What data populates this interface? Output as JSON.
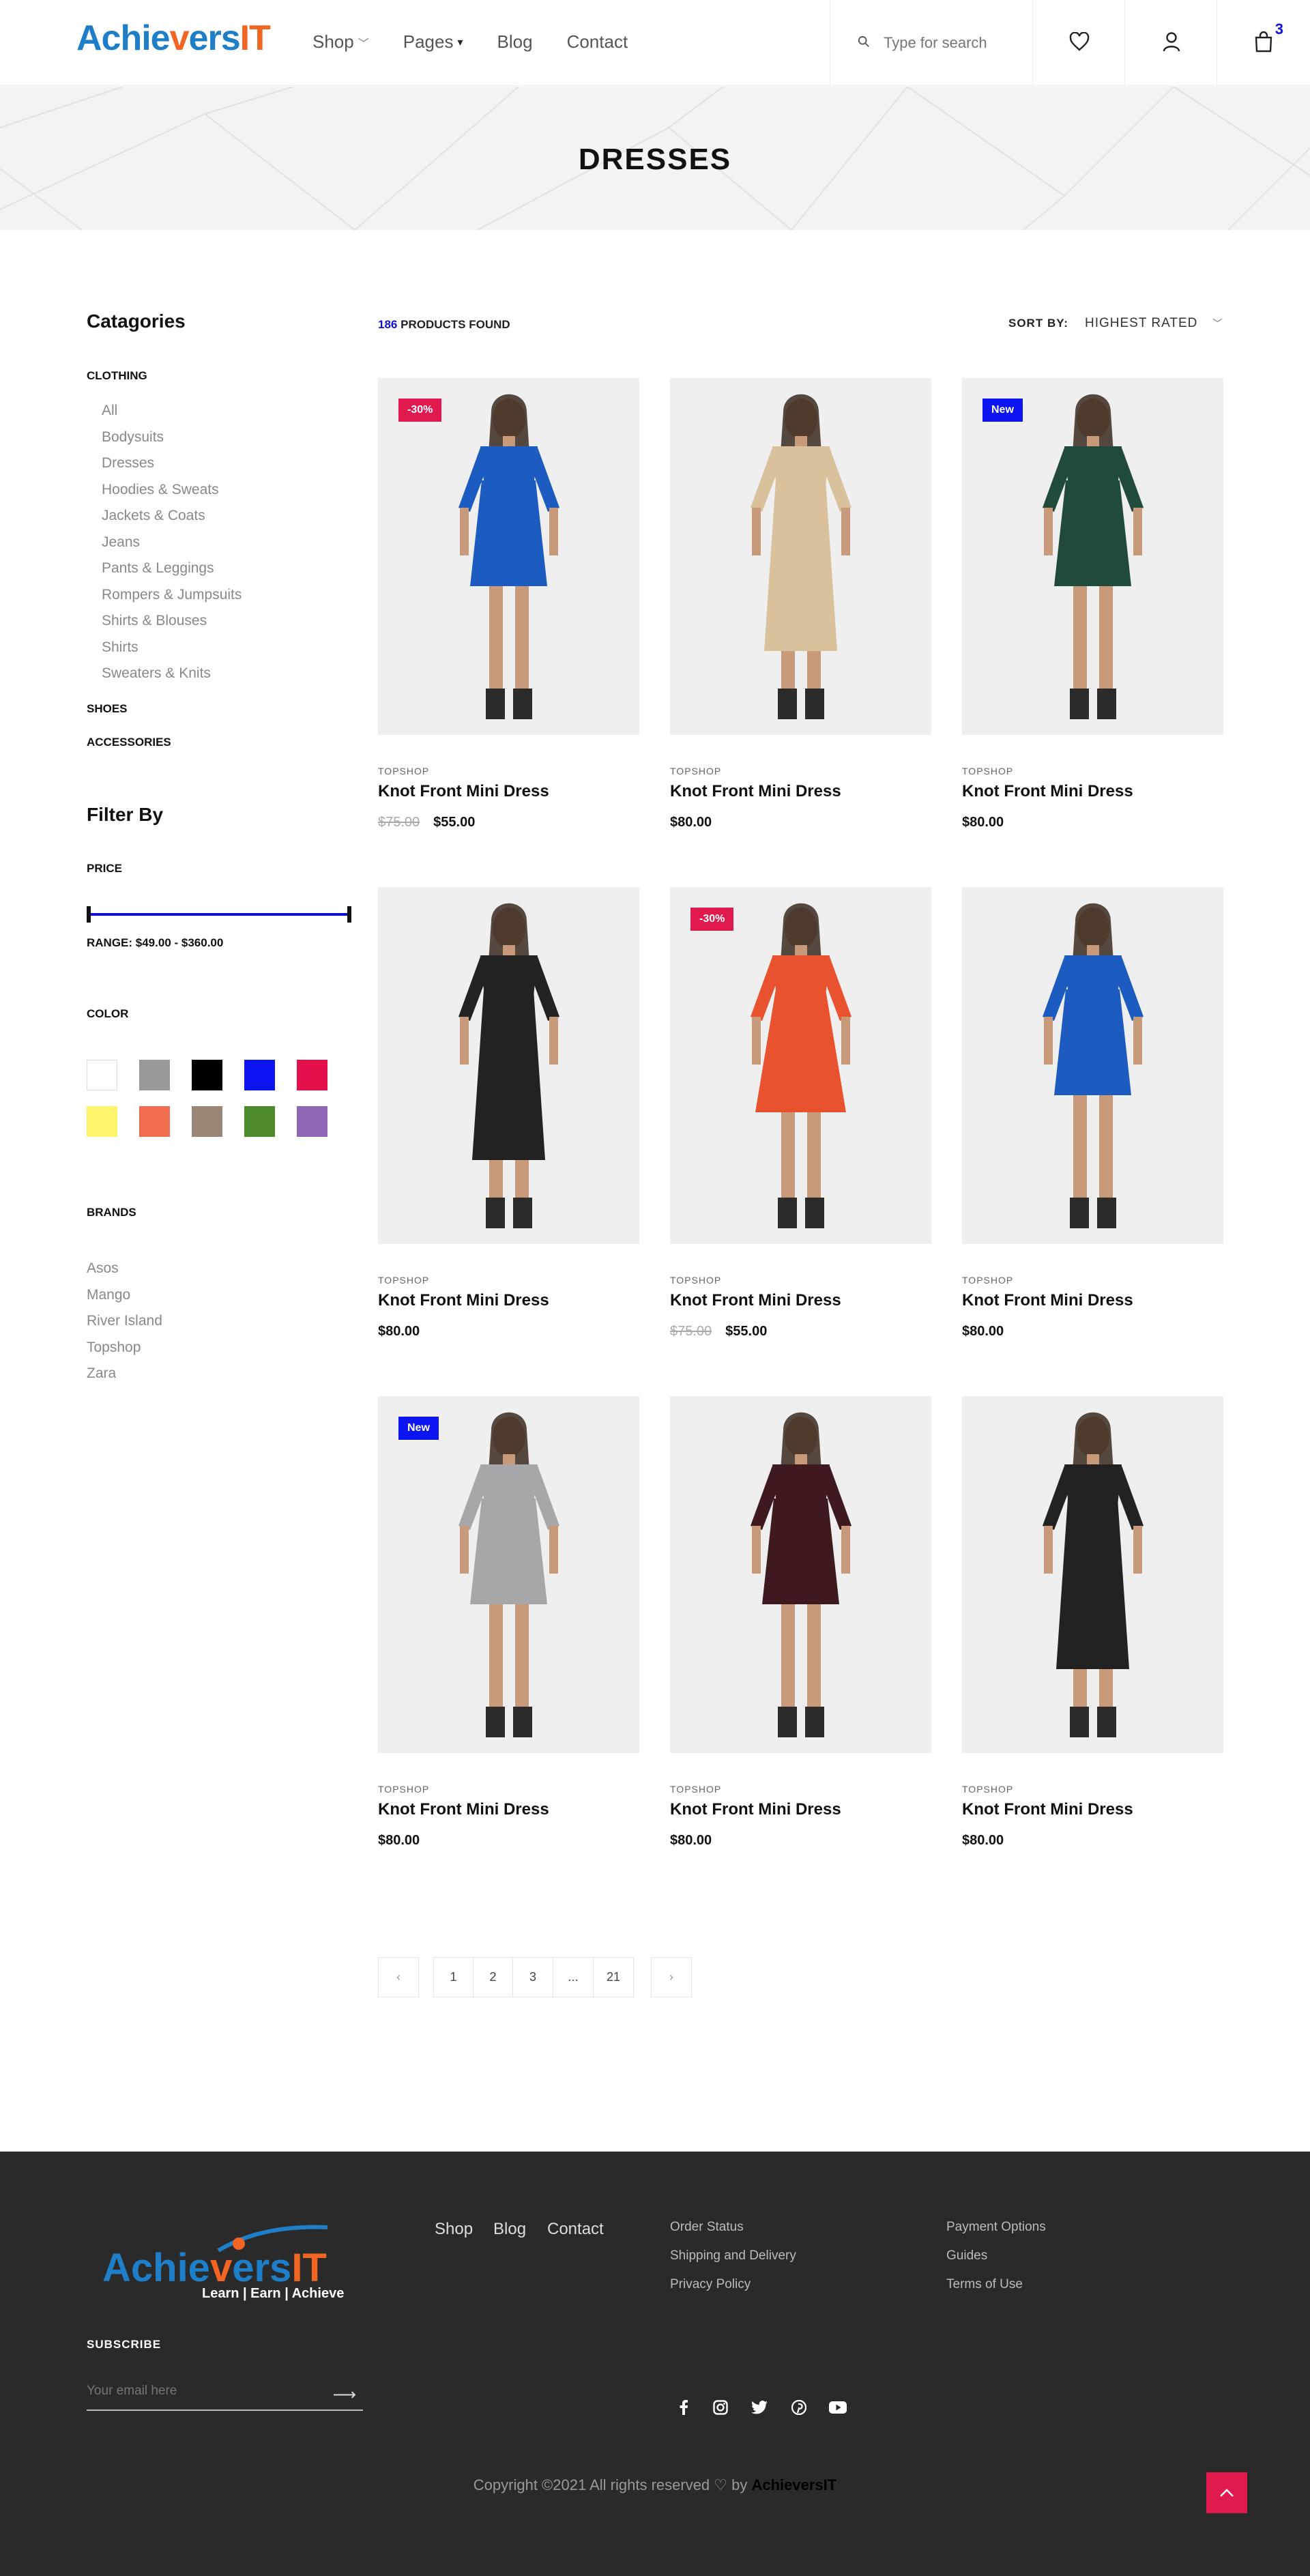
{
  "header": {
    "logo": {
      "part1": "Achie",
      "part2": "v",
      "part3": "ers",
      "part4": "IT"
    },
    "nav": [
      {
        "label": "Shop",
        "has_dropdown": true
      },
      {
        "label": "Pages",
        "has_dropdown": true
      },
      {
        "label": "Blog",
        "has_dropdown": false
      },
      {
        "label": "Contact",
        "has_dropdown": false
      }
    ],
    "search_placeholder": "Type for search",
    "cart_count": "3",
    "icons": [
      "search-icon",
      "heart-icon",
      "user-icon",
      "bag-icon"
    ]
  },
  "banner": {
    "title": "DRESSES"
  },
  "sidebar": {
    "categories_title": "Catagories",
    "clothing_label": "CLOTHING",
    "clothing_items": [
      "All",
      "Bodysuits",
      "Dresses",
      "Hoodies & Sweats",
      "Jackets & Coats",
      "Jeans",
      "Pants & Leggings",
      "Rompers & Jumpsuits",
      "Shirts & Blouses",
      "Shirts",
      "Sweaters & Knits"
    ],
    "shoes_label": "SHOES",
    "accessories_label": "ACCESSORIES",
    "filter_title": "Filter By",
    "price_label": "PRICE",
    "price_range": "RANGE: $49.00 - $360.00",
    "color_label": "COLOR",
    "colors": [
      "#ffffff",
      "#999999",
      "#000000",
      "#0d14f2",
      "#e3104c",
      "#fdf46b",
      "#f06d4d",
      "#9b8577",
      "#4d8a2b",
      "#8e66b5"
    ],
    "brands_label": "BRANDS",
    "brands": [
      "Asos",
      "Mango",
      "River Island",
      "Topshop",
      "Zara"
    ]
  },
  "toolbar": {
    "found_count": "186",
    "found_label": "PRODUCTS FOUND",
    "sort_label": "SORT BY:",
    "sort_value": "HIGHEST RATED"
  },
  "products": [
    {
      "brand": "TOPSHOP",
      "name": "Knot Front Mini Dress",
      "old_price": "$75.00",
      "price": "$55.00",
      "badge": "-30%",
      "badge_color": "#e01a4f",
      "dress_color": "#1c5bc0",
      "style": "short"
    },
    {
      "brand": "TOPSHOP",
      "name": "Knot Front Mini Dress",
      "old_price": "",
      "price": "$80.00",
      "badge": "",
      "badge_color": "",
      "dress_color": "#d8c19b",
      "style": "long"
    },
    {
      "brand": "TOPSHOP",
      "name": "Knot Front Mini Dress",
      "old_price": "",
      "price": "$80.00",
      "badge": "New",
      "badge_color": "#0d14f2",
      "dress_color": "#1f4a3c",
      "style": "short"
    },
    {
      "brand": "TOPSHOP",
      "name": "Knot Front Mini Dress",
      "old_price": "",
      "price": "$80.00",
      "badge": "",
      "badge_color": "",
      "dress_color": "#222222",
      "style": "long"
    },
    {
      "brand": "TOPSHOP",
      "name": "Knot Front Mini Dress",
      "old_price": "$75.00",
      "price": "$55.00",
      "badge": "-30%",
      "badge_color": "#e01a4f",
      "dress_color": "#e8522e",
      "style": "mini"
    },
    {
      "brand": "TOPSHOP",
      "name": "Knot Front Mini Dress",
      "old_price": "",
      "price": "$80.00",
      "badge": "",
      "badge_color": "",
      "dress_color": "#1c5bc0",
      "style": "short"
    },
    {
      "brand": "TOPSHOP",
      "name": "Knot Front Mini Dress",
      "old_price": "",
      "price": "$80.00",
      "badge": "New",
      "badge_color": "#0d14f2",
      "dress_color": "#a7a7aa",
      "style": "short"
    },
    {
      "brand": "TOPSHOP",
      "name": "Knot Front Mini Dress",
      "old_price": "",
      "price": "$80.00",
      "badge": "",
      "badge_color": "",
      "dress_color": "#3e1a1f",
      "style": "short"
    },
    {
      "brand": "TOPSHOP",
      "name": "Knot Front Mini Dress",
      "old_price": "",
      "price": "$80.00",
      "badge": "",
      "badge_color": "",
      "dress_color": "#222222",
      "style": "long"
    }
  ],
  "pagination": {
    "prev": "‹",
    "pages": [
      "1",
      "2",
      "3",
      "...",
      "21"
    ],
    "next": "›"
  },
  "footer": {
    "logo_tagline": "Learn | Earn | Achieve",
    "nav": [
      "Shop",
      "Blog",
      "Contact"
    ],
    "links_col1": [
      "Order Status",
      "Shipping and Delivery",
      "Privacy Policy"
    ],
    "links_col2": [
      "Payment Options",
      "Guides",
      "Terms of Use"
    ],
    "subscribe_label": "SUBSCRIBE",
    "email_placeholder": "Your email here",
    "social": [
      "facebook-icon",
      "instagram-icon",
      "twitter-icon",
      "pinterest-icon",
      "youtube-icon"
    ],
    "copyright_text": "Copyright ©2021 All rights reserved ♡ by",
    "copyright_brand": "AchieversIT"
  }
}
